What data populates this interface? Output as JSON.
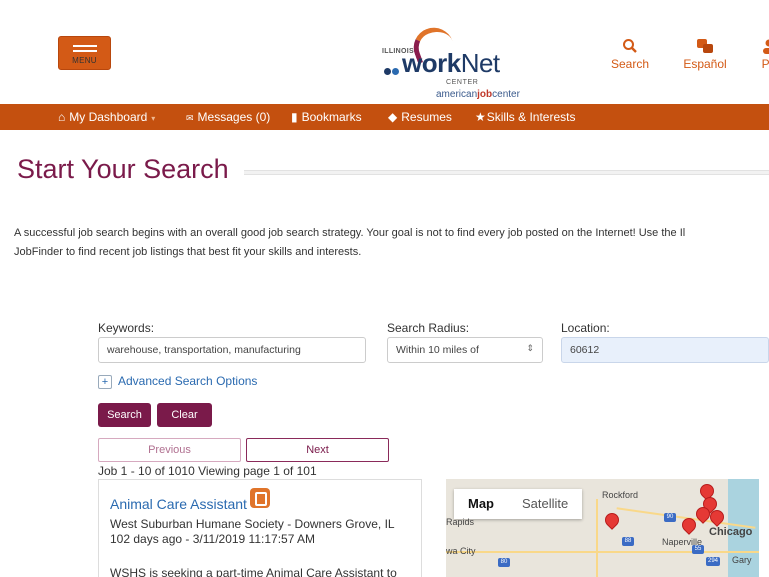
{
  "header": {
    "menu_label": "MENU",
    "logo": {
      "illinois": "ILLINOIS",
      "work": "work",
      "net": "Net",
      "center": "CENTER",
      "ajc_american": "american",
      "ajc_job": "job",
      "ajc_center": "center"
    },
    "links": [
      {
        "label": "Search",
        "icon": "search-icon"
      },
      {
        "label": "Español",
        "icon": "translate-icon"
      },
      {
        "label": "Pa",
        "icon": "person-icon"
      }
    ]
  },
  "nav": {
    "items": [
      {
        "label": "My Dashboard",
        "icon": "home-icon"
      },
      {
        "label": "Messages (0)",
        "icon": "envelope-icon"
      },
      {
        "label": "Bookmarks",
        "icon": "bookmark-icon"
      },
      {
        "label": "Resumes",
        "icon": "resume-icon"
      },
      {
        "label": "Skills & Interests",
        "icon": "star-icon"
      }
    ]
  },
  "page": {
    "title": "Start Your Search",
    "intro_line1": "A successful job search begins with an overall good job search strategy. Your goal is not to find every job posted on the Internet! Use the Il",
    "intro_line2": "JobFinder to find recent job listings that best fit your skills and interests."
  },
  "search": {
    "keywords_label": "Keywords:",
    "keywords_value": "warehouse, transportation, manufacturing",
    "radius_label": "Search Radius:",
    "radius_value": "Within 10 miles of",
    "location_label": "Location:",
    "location_value": "60612",
    "advanced_label": "Advanced Search Options",
    "search_button": "Search",
    "clear_button": "Clear"
  },
  "pagination": {
    "previous": "Previous",
    "next": "Next",
    "summary": "Job 1 - 10 of 1010 Viewing page 1 of 101"
  },
  "job": {
    "title": "Animal Care Assistant",
    "employer": "West Suburban Humane Society - Downers Grove, IL",
    "posted": "102 days ago - 3/11/2019 11:17:57 AM",
    "snippet": "WSHS is seeking a part-time Animal Care Assistant to"
  },
  "map": {
    "tab_map": "Map",
    "tab_satellite": "Satellite",
    "places": {
      "rockford": "Rockford",
      "rapids": "Rapids",
      "naperville": "Naperville",
      "chicago": "Chicago",
      "gary": "Gary",
      "iowa_city": "wa City"
    },
    "shields": {
      "s90": "90",
      "s88": "88",
      "s80": "80",
      "s294": "294",
      "s55": "55"
    }
  },
  "colors": {
    "accent_orange": "#c4500f",
    "brand_maroon": "#7a1a4a",
    "link_blue": "#2a6ab0"
  }
}
